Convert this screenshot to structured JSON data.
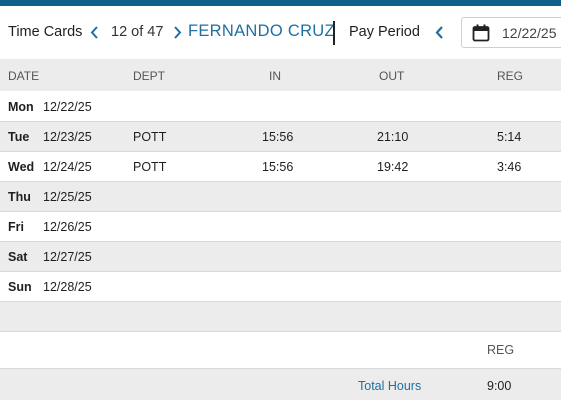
{
  "header": {
    "title": "Time Cards",
    "record_position": "12 of 47",
    "employee_name": "FERNANDO CRUZ",
    "pay_period_label": "Pay Period",
    "pay_period_date": "12/22/25",
    "prev_record_icon": "chevron-left-icon",
    "next_record_icon": "chevron-right-icon",
    "prev_period_icon": "chevron-left-icon",
    "calendar_icon": "calendar-icon"
  },
  "table": {
    "columns": [
      "DATE",
      "DEPT",
      "IN",
      "OUT",
      "REG"
    ],
    "rows": [
      {
        "day": "Mon",
        "date": "12/22/25",
        "dept": "",
        "in": "",
        "out": "",
        "reg": ""
      },
      {
        "day": "Tue",
        "date": "12/23/25",
        "dept": "POTT",
        "in": "15:56",
        "out": "21:10",
        "reg": "5:14"
      },
      {
        "day": "Wed",
        "date": "12/24/25",
        "dept": "POTT",
        "in": "15:56",
        "out": "19:42",
        "reg": "3:46"
      },
      {
        "day": "Thu",
        "date": "12/25/25",
        "dept": "",
        "in": "",
        "out": "",
        "reg": ""
      },
      {
        "day": "Fri",
        "date": "12/26/25",
        "dept": "",
        "in": "",
        "out": "",
        "reg": ""
      },
      {
        "day": "Sat",
        "date": "12/27/25",
        "dept": "",
        "in": "",
        "out": "",
        "reg": ""
      },
      {
        "day": "Sun",
        "date": "12/28/25",
        "dept": "",
        "in": "",
        "out": "",
        "reg": ""
      }
    ]
  },
  "summary": {
    "reg_header": "REG",
    "total_label": "Total Hours",
    "total_reg": "9:00"
  },
  "colors": {
    "accent": "#1f6fa3",
    "top_bar": "#0f5e8c",
    "alt_row": "#ececec"
  }
}
